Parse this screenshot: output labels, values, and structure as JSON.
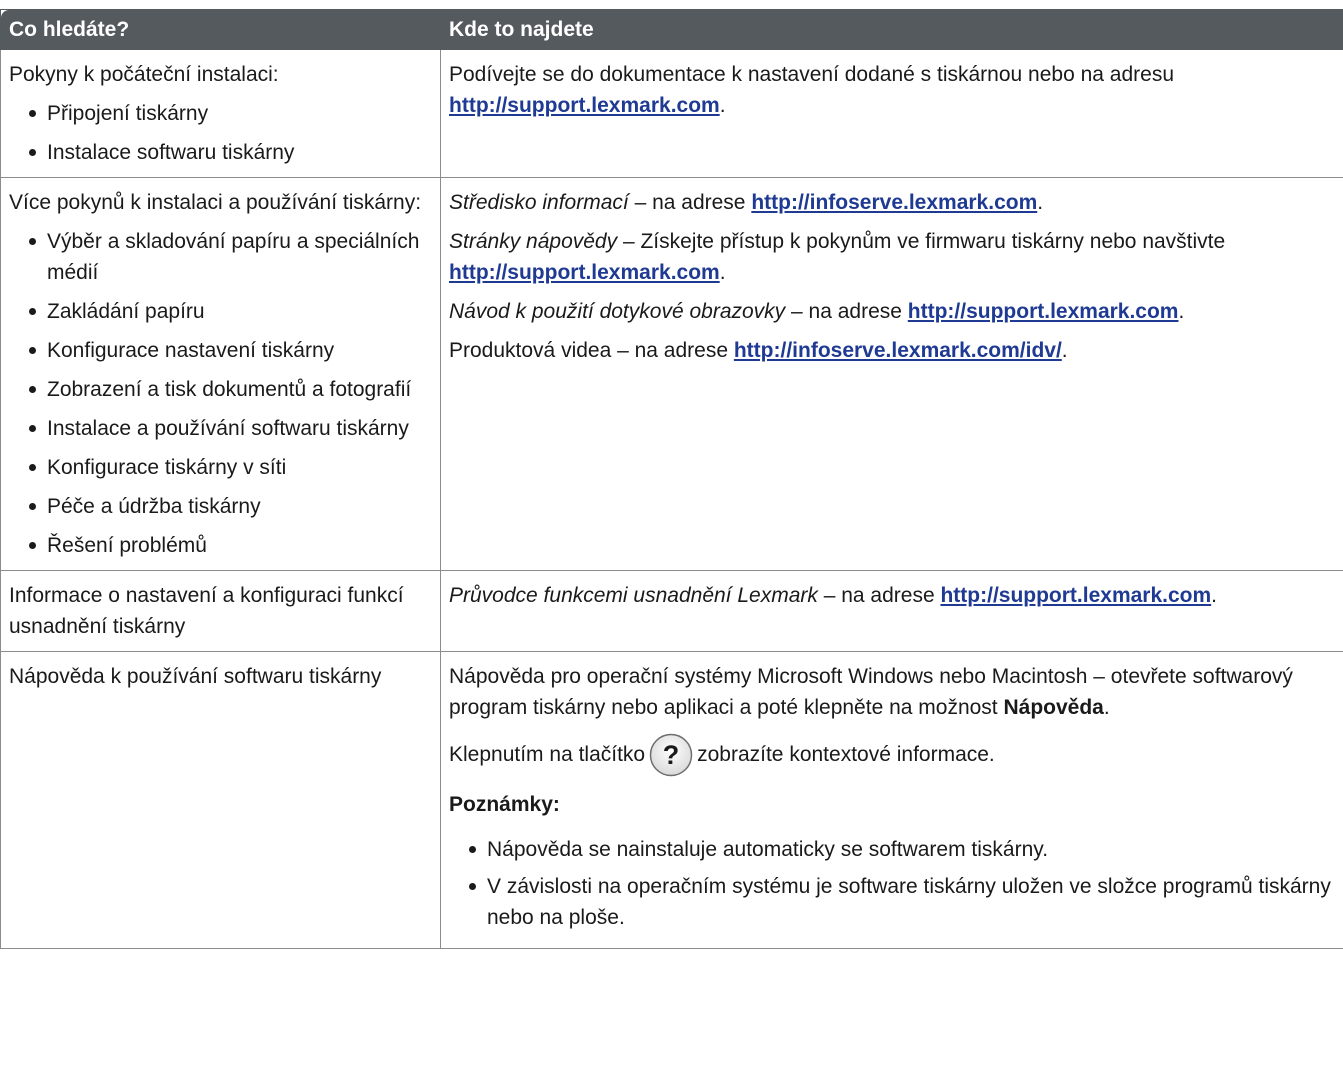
{
  "header": {
    "col1": "Co hledáte?",
    "col2": "Kde to najdete"
  },
  "rows": [
    {
      "topic": "Pokyny k počáteční instalaci:",
      "topic_items": [
        "Připojení tiskárny",
        "Instalace softwaru tiskárny"
      ],
      "where": {
        "text": "Podívejte se do dokumentace k nastavení dodané s tiskárnou nebo na adresu",
        "link": "http://support.lexmark.com",
        "end": "."
      }
    },
    {
      "topic": "Více pokynů k instalaci a používání tiskárny:",
      "topic_items": [
        "Výběr a skladování papíru a speciálních médií",
        "Zakládání papíru",
        "Konfigurace nastavení tiskárny",
        "Zobrazení a tisk dokumentů a fotografií",
        "Instalace a používání softwaru tiskárny",
        "Konfigurace tiskárny v síti",
        "Péče a údržba tiskárny",
        "Řešení problémů"
      ],
      "where": [
        {
          "italic": "Středisko informací",
          "text": " – na adrese ",
          "link": "http://infoserve.lexmark.com",
          "end": "."
        },
        {
          "italic": "Stránky nápovědy",
          "text": " – Získejte přístup k pokynům ve firmwaru tiskárny nebo navštivte ",
          "link": "http://support.lexmark.com",
          "end": "."
        },
        {
          "italic": "Návod k použití dotykové obrazovky",
          "text": " – na adrese ",
          "link": "http://support.lexmark.com",
          "end": "."
        },
        {
          "italic": "",
          "text": "Produktová videa – na adrese ",
          "link": "http://infoserve.lexmark.com/idv/",
          "end": "."
        }
      ]
    },
    {
      "topic": "Informace o nastavení a konfiguraci funkcí usnadnění tiskárny",
      "where": {
        "italic": "Průvodce funkcemi usnadnění Lexmark",
        "text": " – na adrese ",
        "link": "http://support.lexmark.com",
        "end": "."
      }
    },
    {
      "topic": "Nápověda k používání softwaru tiskárny",
      "where": {
        "intro": "Nápověda pro operační systémy Microsoft Windows nebo Macintosh – otevřete softwarový program tiskárny nebo aplikaci a poté klepněte na možnost ",
        "intro_bold": "Nápověda",
        "intro_end": ".",
        "help_before": "Klepnutím na tlačítko",
        "help_after": "zobrazíte kontextové informace.",
        "notes_title": "Poznámky:",
        "notes": [
          "Nápověda se nainstaluje automaticky se softwarem tiskárny.",
          "V závislosti na operačním systému je software tiskárny uložen ve složce programů tiskárny nebo na ploše."
        ]
      }
    }
  ]
}
